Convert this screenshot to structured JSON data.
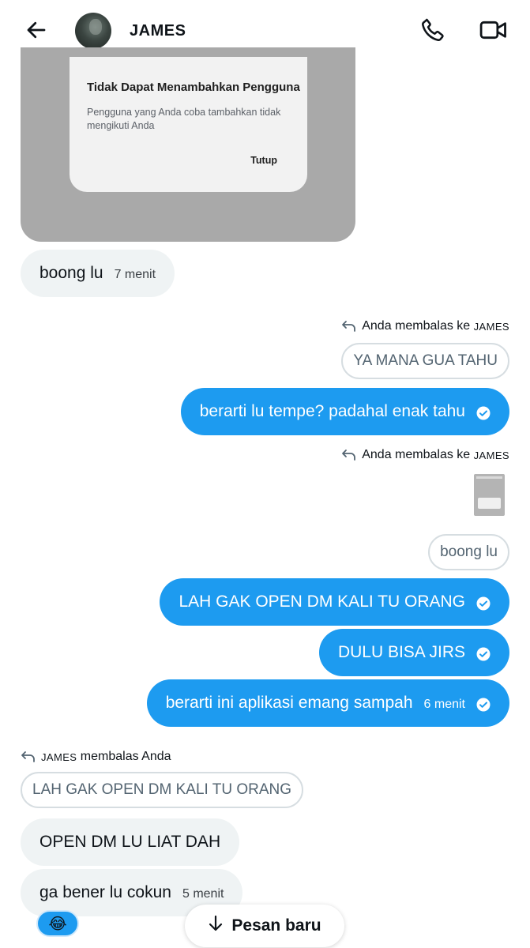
{
  "header": {
    "name": "JAMES",
    "back_icon": "arrow-left-icon",
    "call_icon": "phone-icon",
    "video_icon": "video-camera-icon"
  },
  "image_message": {
    "dialog_title": "Tidak Dapat Menambahkan Pengguna",
    "dialog_text": "Pengguna yang Anda coba tambahkan tidak mengikuti Anda",
    "dialog_button": "Tutup"
  },
  "messages": {
    "m1": {
      "text": "boong lu",
      "time": "7 menit"
    },
    "reply1": {
      "prefix": "Anda membalas ke",
      "name": "JAMES"
    },
    "quote1": "YA MANA GUA TAHU",
    "m2": {
      "text": "berarti lu tempe? padahal enak tahu"
    },
    "reply2": {
      "prefix": "Anda membalas ke",
      "name": "JAMES"
    },
    "quote2": "boong lu",
    "m3": {
      "text": "LAH GAK OPEN DM KALI TU ORANG"
    },
    "m4": {
      "text": "DULU BISA JIRS"
    },
    "m5": {
      "text": "berarti ini aplikasi emang sampah",
      "time": "6 menit"
    },
    "reply3": {
      "name": "JAMES",
      "suffix": "membalas Anda"
    },
    "quote3": "LAH GAK OPEN DM KALI TU ORANG",
    "m6": {
      "text": "OPEN DM LU LIAT DAH"
    },
    "m7": {
      "text": "ga bener lu cokun",
      "time": "5 menit"
    }
  },
  "reaction": {
    "emoji": "😂"
  },
  "new_message_button": {
    "label": "Pesan baru"
  },
  "colors": {
    "accent": "#1d9bf0",
    "received_bubble": "#eff3f4"
  }
}
